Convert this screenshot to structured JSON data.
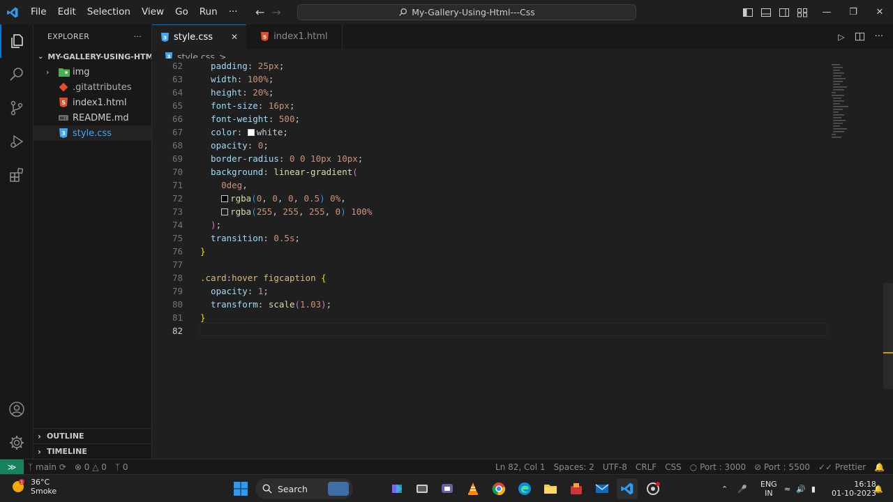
{
  "menu": [
    "File",
    "Edit",
    "Selection",
    "View",
    "Go",
    "Run",
    "···"
  ],
  "search": {
    "text": "My-Gallery-Using-Html---Css"
  },
  "explorer": {
    "title": "EXPLORER",
    "more": "···",
    "folder": "MY-GALLERY-USING-HTM...",
    "items": [
      {
        "label": "img",
        "icon": "folder-image-icon",
        "color": "#4caf50"
      },
      {
        "label": ".gitattributes",
        "icon": "git-icon",
        "color": "#e44d26"
      },
      {
        "label": "index1.html",
        "icon": "html-icon",
        "color": "#e44d26"
      },
      {
        "label": "README.md",
        "icon": "markdown-icon",
        "color": "#6c6c6c"
      },
      {
        "label": "style.css",
        "icon": "css-icon",
        "color": "#42a5f5"
      }
    ],
    "outline": "OUTLINE",
    "timeline": "TIMELINE"
  },
  "tabs": [
    {
      "label": "style.css",
      "active": true,
      "close": "✕"
    },
    {
      "label": "index1.html",
      "active": false
    }
  ],
  "breadcrumb": {
    "file": "style.css",
    "sep": ">",
    "rest": "..."
  },
  "code_lines": [
    {
      "num": "62",
      "tokens": [
        [
          "k",
          "  padding"
        ],
        [
          "p",
          ": "
        ],
        [
          "n",
          "25px"
        ],
        [
          "p",
          ";"
        ]
      ]
    },
    {
      "num": "63",
      "tokens": [
        [
          "k",
          "  width"
        ],
        [
          "p",
          ": "
        ],
        [
          "n",
          "100%"
        ],
        [
          "p",
          ";"
        ]
      ]
    },
    {
      "num": "64",
      "tokens": [
        [
          "k",
          "  height"
        ],
        [
          "p",
          ": "
        ],
        [
          "n",
          "20%"
        ],
        [
          "p",
          ";"
        ]
      ]
    },
    {
      "num": "65",
      "tokens": [
        [
          "k",
          "  font-size"
        ],
        [
          "p",
          ": "
        ],
        [
          "n",
          "16px"
        ],
        [
          "p",
          ";"
        ]
      ]
    },
    {
      "num": "66",
      "tokens": [
        [
          "k",
          "  font-weight"
        ],
        [
          "p",
          ": "
        ],
        [
          "n",
          "500"
        ],
        [
          "p",
          ";"
        ]
      ]
    },
    {
      "num": "67",
      "tokens": [
        [
          "k",
          "  color"
        ],
        [
          "p",
          ": "
        ],
        [
          "sw",
          "#ffffff"
        ],
        [
          "p",
          "white;"
        ]
      ]
    },
    {
      "num": "68",
      "tokens": [
        [
          "k",
          "  opacity"
        ],
        [
          "p",
          ": "
        ],
        [
          "n",
          "0"
        ],
        [
          "p",
          ";"
        ]
      ]
    },
    {
      "num": "69",
      "tokens": [
        [
          "k",
          "  border-radius"
        ],
        [
          "p",
          ": "
        ],
        [
          "n",
          "0 0 10px 10px"
        ],
        [
          "p",
          ";"
        ]
      ]
    },
    {
      "num": "70",
      "tokens": [
        [
          "k",
          "  background"
        ],
        [
          "p",
          ": "
        ],
        [
          "f",
          "linear-gradient"
        ],
        [
          "bp",
          "("
        ]
      ]
    },
    {
      "num": "71",
      "tokens": [
        [
          "n",
          "    0deg"
        ],
        [
          "p",
          ","
        ]
      ]
    },
    {
      "num": "72",
      "tokens": [
        [
          "p",
          "    "
        ],
        [
          "sw",
          "#000000"
        ],
        [
          "f",
          "rgba"
        ],
        [
          "bb",
          "("
        ],
        [
          "n",
          "0"
        ],
        [
          "p",
          ", "
        ],
        [
          "n",
          "0"
        ],
        [
          "p",
          ", "
        ],
        [
          "n",
          "0"
        ],
        [
          "p",
          ", "
        ],
        [
          "n",
          "0.5"
        ],
        [
          "bb",
          ")"
        ],
        [
          "n",
          " 0%"
        ],
        [
          "p",
          ","
        ]
      ]
    },
    {
      "num": "73",
      "tokens": [
        [
          "p",
          "    "
        ],
        [
          "sw",
          "#1f1f1f"
        ],
        [
          "f",
          "rgba"
        ],
        [
          "bb",
          "("
        ],
        [
          "n",
          "255"
        ],
        [
          "p",
          ", "
        ],
        [
          "n",
          "255"
        ],
        [
          "p",
          ", "
        ],
        [
          "n",
          "255"
        ],
        [
          "p",
          ", "
        ],
        [
          "n",
          "0"
        ],
        [
          "bb",
          ")"
        ],
        [
          "n",
          " 100%"
        ]
      ]
    },
    {
      "num": "74",
      "tokens": [
        [
          "bp",
          "  )"
        ],
        [
          "p",
          ";"
        ]
      ]
    },
    {
      "num": "75",
      "tokens": [
        [
          "k",
          "  transition"
        ],
        [
          "p",
          ": "
        ],
        [
          "n",
          "0.5s"
        ],
        [
          "p",
          ";"
        ]
      ]
    },
    {
      "num": "76",
      "tokens": [
        [
          "b",
          "}"
        ]
      ]
    },
    {
      "num": "77",
      "tokens": []
    },
    {
      "num": "78",
      "tokens": [
        [
          "s",
          ".card"
        ],
        [
          "p",
          ":"
        ],
        [
          "s",
          "hover"
        ],
        [
          "p",
          " "
        ],
        [
          "s",
          "figcaption"
        ],
        [
          "p",
          " "
        ],
        [
          "b",
          "{"
        ]
      ]
    },
    {
      "num": "79",
      "tokens": [
        [
          "k",
          "  opacity"
        ],
        [
          "p",
          ": "
        ],
        [
          "n",
          "1"
        ],
        [
          "p",
          ";"
        ]
      ]
    },
    {
      "num": "80",
      "tokens": [
        [
          "k",
          "  transform"
        ],
        [
          "p",
          ": "
        ],
        [
          "f",
          "scale"
        ],
        [
          "bp",
          "("
        ],
        [
          "n",
          "1.03"
        ],
        [
          "bp",
          ")"
        ],
        [
          "p",
          ";"
        ]
      ]
    },
    {
      "num": "81",
      "tokens": [
        [
          "b",
          "}"
        ]
      ]
    },
    {
      "num": "82",
      "tokens": []
    }
  ],
  "statusbar": {
    "branch": "main",
    "errors": "0",
    "warnings": "0",
    "ports": "0",
    "position": "Ln 82, Col 1",
    "spaces": "Spaces: 2",
    "encoding": "UTF-8",
    "eol": "CRLF",
    "language": "CSS",
    "port1": "Port : 3000",
    "port2": "Port : 5500",
    "prettier": "Prettier"
  },
  "taskbar": {
    "temp": "36°C",
    "weather": "Smoke",
    "search": "Search",
    "lang1": "ENG",
    "lang2": "IN",
    "time": "16:18",
    "date": "01-10-2023"
  },
  "colors": {
    "accent": "#0078d4",
    "remote": "#16825d"
  }
}
